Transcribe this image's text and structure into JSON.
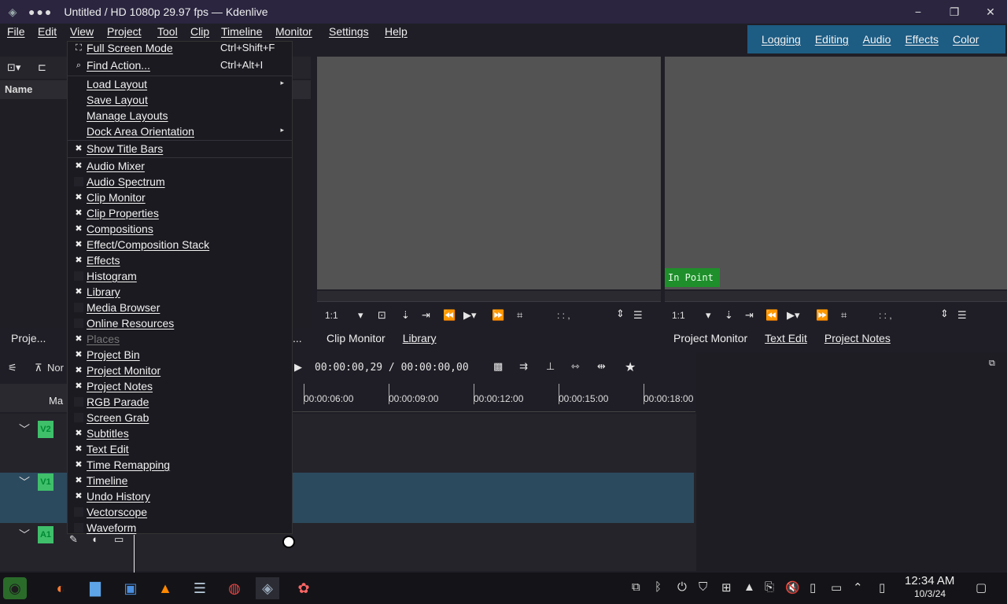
{
  "window": {
    "title": "Untitled / HD 1080p 29.97 fps — Kdenlive",
    "dots": "●●●",
    "minimize": "−",
    "maximize": "❐",
    "close": "✕"
  },
  "menubar": {
    "items": [
      "File",
      "Edit",
      "View",
      "Project",
      "Tool",
      "Clip",
      "Timeline",
      "Monitor",
      "Settings",
      "Help"
    ]
  },
  "layouts": [
    "Logging",
    "Editing",
    "Audio",
    "Effects",
    "Color"
  ],
  "bin": {
    "name_header": "Name"
  },
  "view_menu": {
    "items": [
      {
        "label": "Full Screen Mode",
        "shortcut": "Ctrl+Shift+F",
        "check": "icon"
      },
      {
        "label": "Find Action...",
        "shortcut": "Ctrl+Alt+I",
        "check": "icon"
      },
      {
        "label": "Load Layout",
        "submenu": "▸"
      },
      {
        "label": "Save Layout"
      },
      {
        "label": "Manage Layouts"
      },
      {
        "label": "Dock Area Orientation",
        "submenu": "▸"
      },
      {
        "label": "Show Title Bars",
        "check": "x"
      },
      {
        "label": "Audio Mixer",
        "check": "x"
      },
      {
        "label": "Audio Spectrum",
        "check": "box"
      },
      {
        "label": "Clip Monitor",
        "check": "x"
      },
      {
        "label": "Clip Properties",
        "check": "x"
      },
      {
        "label": "Compositions",
        "check": "x"
      },
      {
        "label": "Effect/Composition Stack",
        "check": "x"
      },
      {
        "label": "Effects",
        "check": "x"
      },
      {
        "label": "Histogram",
        "check": "box"
      },
      {
        "label": "Library",
        "check": "x"
      },
      {
        "label": "Media Browser",
        "check": "box"
      },
      {
        "label": "Online Resources",
        "check": "box"
      },
      {
        "label": "Places",
        "check": "x",
        "disabled": true
      },
      {
        "label": "Project Bin",
        "check": "x"
      },
      {
        "label": "Project Monitor",
        "check": "x"
      },
      {
        "label": "Project Notes",
        "check": "x"
      },
      {
        "label": "RGB Parade",
        "check": "box"
      },
      {
        "label": "Screen Grab",
        "check": "box"
      },
      {
        "label": "Subtitles",
        "check": "x"
      },
      {
        "label": "Text Edit",
        "check": "x"
      },
      {
        "label": "Time Remapping",
        "check": "x"
      },
      {
        "label": "Timeline",
        "check": "x"
      },
      {
        "label": "Undo History",
        "check": "x"
      },
      {
        "label": "Vectorscope",
        "check": "box"
      },
      {
        "label": "Waveform",
        "check": "box"
      }
    ]
  },
  "clip_monitor": {
    "zoom": "1:1",
    "timecode": ":  :  ,"
  },
  "project_monitor": {
    "zoom": "1:1",
    "timecode": ":  :  ,",
    "in_point": "In Point"
  },
  "tabs_left": {
    "project": "Proje...",
    "ellipsis": "..."
  },
  "tabs_clip": [
    "Clip Monitor",
    "Library"
  ],
  "tabs_project": [
    "Project Monitor",
    "Text Edit",
    "Project Notes"
  ],
  "timeline": {
    "mode": "Nor",
    "master": "Ma",
    "timecode": "00:00:00,29 / 00:00:00,00",
    "ticks": [
      "00:00:06:00",
      "00:00:09:00",
      "00:00:12:00",
      "00:00:15:00",
      "00:00:18:00"
    ],
    "tracks": [
      "V2",
      "V1",
      "A1"
    ]
  },
  "taskbar": {
    "time": "12:34 AM",
    "date": "10/3/24"
  }
}
